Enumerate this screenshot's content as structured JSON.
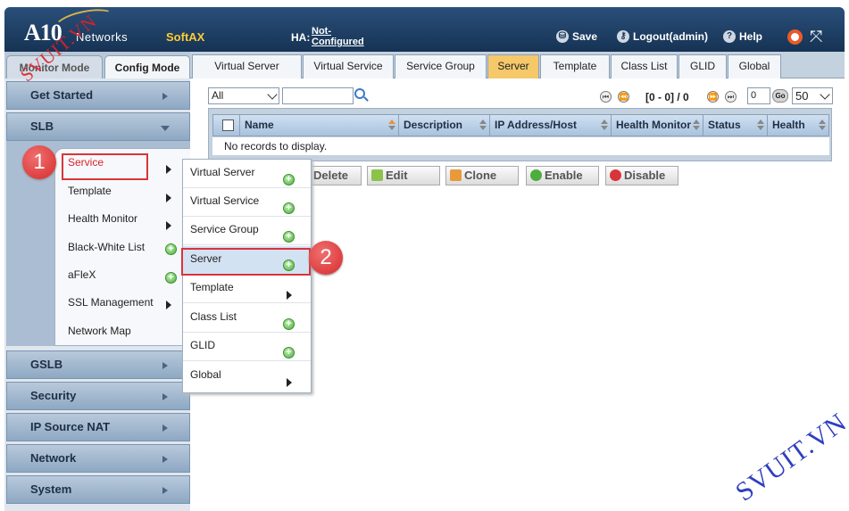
{
  "header": {
    "logo": "A10",
    "logo_sub": "Networks",
    "product": "SoftAX",
    "ha_label": "HA:",
    "ha_value": "Not-Configured",
    "save": "Save",
    "logout": "Logout(admin)",
    "help": "Help"
  },
  "mode_tabs": {
    "monitor": "Monitor Mode",
    "config": "Config Mode"
  },
  "nav": {
    "get_started": "Get Started",
    "slb": "SLB",
    "slb_items": [
      "Service",
      "Template",
      "Health Monitor",
      "Black-White List",
      "aFleX",
      "SSL Management",
      "Network Map"
    ],
    "gslb": "GSLB",
    "security": "Security",
    "ip_source_nat": "IP Source NAT",
    "network": "Network",
    "system": "System"
  },
  "tabs": [
    "Virtual Server",
    "Virtual Service",
    "Service Group",
    "Server",
    "Template",
    "Class List",
    "GLID",
    "Global"
  ],
  "active_tab": "Server",
  "toolbar": {
    "filter_value": "All",
    "page_info": "[0 - 0] / 0",
    "page_input": "0",
    "go": "Go",
    "per_page": "50"
  },
  "table": {
    "columns": [
      "Name",
      "Description",
      "IP Address/Host",
      "Health Monitor",
      "Status",
      "Health"
    ],
    "empty_text": "No records to display."
  },
  "actions": [
    "Delete",
    "Edit",
    "Clone",
    "Enable",
    "Disable"
  ],
  "flyout": [
    "Virtual Server",
    "Virtual Service",
    "Service Group",
    "Server",
    "Template",
    "Class List",
    "GLID",
    "Global"
  ],
  "annotations": {
    "step1": "1",
    "step2": "2"
  },
  "watermark_left": "SVUIT.VN",
  "watermark_right": "SVUIT.VN",
  "colors": {
    "header": "#1e3d63",
    "accent_tab": "#f5c86a",
    "highlight": "#d9343a",
    "product": "#ffcc33"
  }
}
